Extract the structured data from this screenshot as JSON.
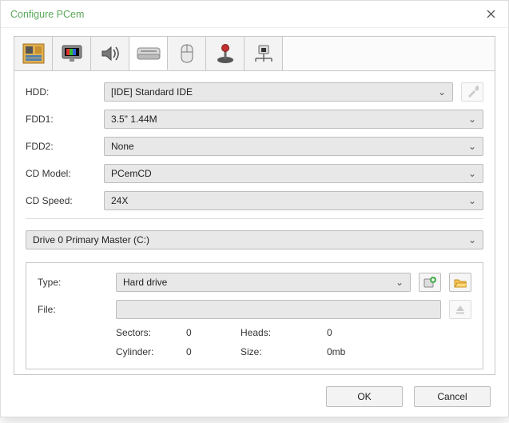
{
  "window": {
    "title": "Configure PCem"
  },
  "tabs": [
    {
      "name": "motherboard-tab"
    },
    {
      "name": "display-tab"
    },
    {
      "name": "sound-tab"
    },
    {
      "name": "drives-tab"
    },
    {
      "name": "mouse-tab"
    },
    {
      "name": "joystick-tab"
    },
    {
      "name": "network-tab"
    }
  ],
  "fields": {
    "hdd": {
      "label": "HDD:",
      "value": "[IDE] Standard IDE"
    },
    "fdd1": {
      "label": "FDD1:",
      "value": "3.5\" 1.44M"
    },
    "fdd2": {
      "label": "FDD2:",
      "value": "None"
    },
    "cd_model": {
      "label": "CD Model:",
      "value": "PCemCD"
    },
    "cd_speed": {
      "label": "CD Speed:",
      "value": "24X"
    }
  },
  "drive_select": {
    "value": "Drive 0 Primary Master (C:)"
  },
  "drive_detail": {
    "type_label": "Type:",
    "type_value": "Hard drive",
    "file_label": "File:",
    "file_value": "",
    "geom": {
      "sectors_label": "Sectors:",
      "sectors_value": "0",
      "heads_label": "Heads:",
      "heads_value": "0",
      "cylinder_label": "Cylinder:",
      "cylinder_value": "0",
      "size_label": "Size:",
      "size_value": "0mb"
    }
  },
  "buttons": {
    "ok": "OK",
    "cancel": "Cancel"
  }
}
